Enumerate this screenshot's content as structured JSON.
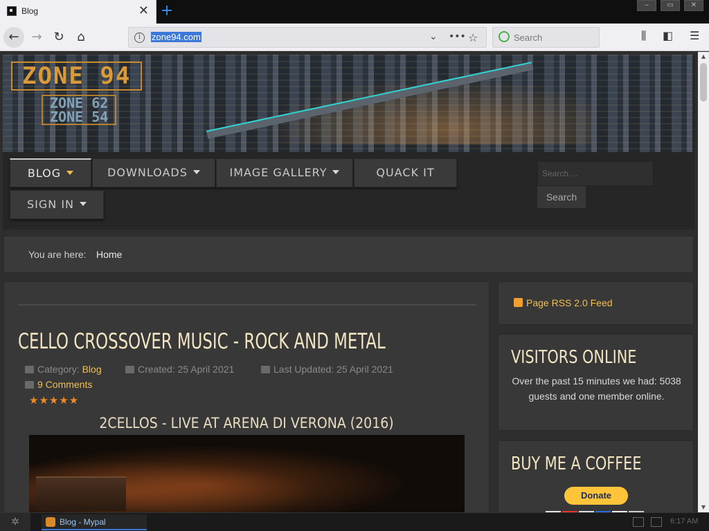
{
  "browser": {
    "tab_title": "Blog",
    "new_tab_label": "+",
    "close_label": "✕",
    "url": "zone94.com",
    "search_placeholder": "Search",
    "info_label": "i"
  },
  "site": {
    "logo_main": "ZONE 94",
    "logo_sub_1": "ZONE 62",
    "logo_sub_2": "ZONE 54",
    "menu": [
      {
        "label": "BLOG"
      },
      {
        "label": "DOWNLOADS"
      },
      {
        "label": "IMAGE GALLERY"
      },
      {
        "label": "QUACK IT"
      },
      {
        "label": "SIGN IN"
      }
    ],
    "search_placeholder": "Search ...",
    "search_button": "Search",
    "breadcrumb_label": "You are here:",
    "breadcrumb_home": "Home"
  },
  "article": {
    "title": "CELLO CROSSOVER MUSIC - ROCK AND METAL",
    "category_label": "Category:",
    "category_value": "Blog",
    "created": "Created: 25 April 2021",
    "updated": "Last Updated: 25 April 2021",
    "comments": "9 Comments",
    "rating_stars": "★★★★★",
    "rating_value": 5,
    "video_title": "2CELLOS - LIVE AT ARENA DI VERONA (2016)"
  },
  "sidebar": {
    "rss": "Page RSS 2.0 Feed",
    "visitors_title": "VISITORS ONLINE",
    "visitors_text": "Over the past 15 minutes we had: 5038 guests and one member online.",
    "coffee_title": "BUY ME A COFFEE",
    "donate_label": "Donate"
  },
  "taskbar": {
    "task_label": "Blog - Mypal",
    "clock": "6:17 AM"
  },
  "colors": {
    "accent_gold": "#f0c050",
    "title_cream": "#f1e4c2",
    "star_orange": "#f08a24",
    "url_highlight": "#3b78d8"
  }
}
